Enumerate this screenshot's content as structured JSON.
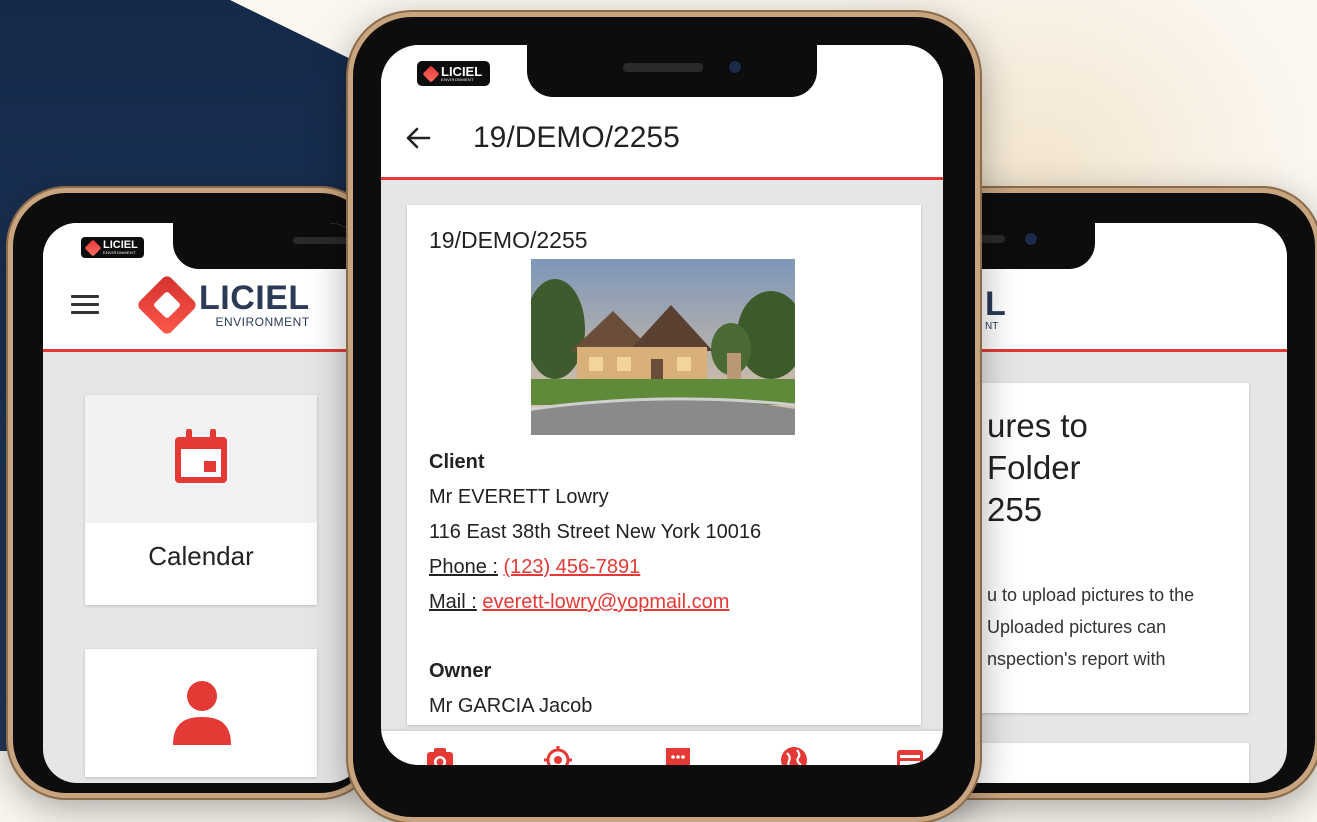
{
  "brand": {
    "name": "LICIEL",
    "sub": "ENVIRONMENT",
    "mini_name": "LICIEL",
    "mini_sub": "ENVIRONMENT",
    "red": "#e53935",
    "navy": "#2b3a55"
  },
  "left_screen": {
    "tiles": [
      {
        "label": "Calendar",
        "icon": "calendar-icon"
      },
      {
        "label": "",
        "icon": "person-icon"
      }
    ]
  },
  "center_screen": {
    "app_title": "19/DEMO/2255",
    "folder_number": "19/DEMO/2255",
    "photo": "house-photo",
    "client": {
      "heading": "Client",
      "name": "Mr EVERETT Lowry",
      "address": "116 East 38th Street New York 10016",
      "phone_label": "Phone :",
      "phone": "(123) 456-7891",
      "mail_label": "Mail :",
      "mail": "everett-lowry@yopmail.com"
    },
    "owner": {
      "heading": "Owner",
      "name": "Mr GARCIA Jacob"
    },
    "bottom_nav": [
      {
        "icon": "camera-icon"
      },
      {
        "icon": "target-icon"
      },
      {
        "icon": "chat-icon"
      },
      {
        "icon": "globe-icon"
      },
      {
        "icon": "card-icon"
      }
    ]
  },
  "right_screen": {
    "logo_fragment": "L",
    "logo_sub_fragment": "NT",
    "heading_lines": [
      "ures to",
      "Folder",
      "255"
    ],
    "body_lines": [
      "u to upload pictures to the",
      "Uploaded pictures can",
      "nspection's report with"
    ]
  }
}
